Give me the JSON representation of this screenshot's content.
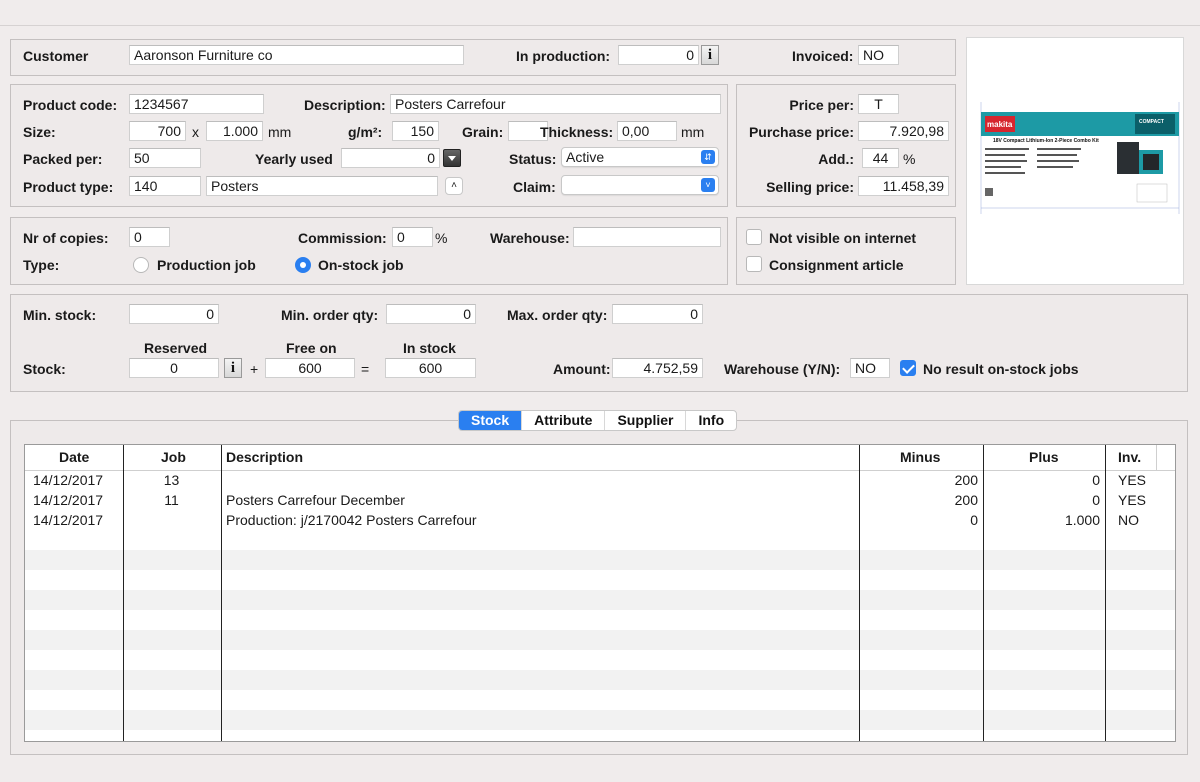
{
  "customer": {
    "label": "Customer",
    "value": "Aaronson Furniture co",
    "in_production_label": "In production:",
    "in_production_value": "0",
    "invoiced_label": "Invoiced:",
    "invoiced_value": "NO"
  },
  "product": {
    "code_label": "Product code:",
    "code": "1234567",
    "description_label": "Description:",
    "description": "Posters Carrefour",
    "size_label": "Size:",
    "size_w": "700",
    "size_x": "x",
    "size_h": "1.000",
    "size_unit": "mm",
    "gsm_label": "g/m²:",
    "gsm": "150",
    "grain_label": "Grain:",
    "grain": "",
    "thickness_label": "Thickness:",
    "thickness": "0,00",
    "thickness_unit": "mm",
    "packed_label": "Packed per:",
    "packed": "50",
    "yearly_label": "Yearly used",
    "yearly": "0",
    "status_label": "Status:",
    "status": "Active",
    "type_label": "Product type:",
    "type_code": "140",
    "type_name": "Posters",
    "claim_label": "Claim:",
    "claim": ""
  },
  "price": {
    "price_per_label": "Price per:",
    "price_per": "T",
    "purchase_label": "Purchase price:",
    "purchase": "7.920,98",
    "add_label": "Add.:",
    "add": "44",
    "add_unit": "%",
    "selling_label": "Selling price:",
    "selling": "11.458,39"
  },
  "copies": {
    "nr_label": "Nr of copies:",
    "nr": "0",
    "commission_label": "Commission:",
    "commission": "0",
    "commission_unit": "%",
    "warehouse_label": "Warehouse:",
    "warehouse": "",
    "type_label": "Type:",
    "production_job": "Production job",
    "onstock_job": "On-stock job"
  },
  "flags": {
    "not_visible": "Not visible on internet",
    "consignment": "Consignment article"
  },
  "stock": {
    "min_stock_label": "Min. stock:",
    "min_stock": "0",
    "min_order_label": "Min. order qty:",
    "min_order": "0",
    "max_order_label": "Max. order qty:",
    "max_order": "0",
    "stock_label": "Stock:",
    "reserved_label": "Reserved",
    "reserved": "0",
    "plus": "+",
    "free_label": "Free on",
    "free": "600",
    "equals": "=",
    "instock_label": "In stock",
    "instock": "600",
    "amount_label": "Amount:",
    "amount": "4.752,59",
    "warehouse_yn_label": "Warehouse (Y/N):",
    "warehouse_yn": "NO",
    "no_result_label": "No result on-stock jobs"
  },
  "tabs": [
    {
      "label": "Stock",
      "active": true
    },
    {
      "label": "Attribute",
      "active": false
    },
    {
      "label": "Supplier",
      "active": false
    },
    {
      "label": "Info",
      "active": false
    }
  ],
  "table": {
    "headers": [
      "Date",
      "Job",
      "Description",
      "Minus",
      "Plus",
      "Inv."
    ],
    "rows": [
      [
        "14/12/2017",
        "13",
        "",
        "200",
        "0",
        "YES"
      ],
      [
        "14/12/2017",
        "11",
        "Posters Carrefour December",
        "200",
        "0",
        "YES"
      ],
      [
        "14/12/2017",
        "",
        "Production: j/2170042 Posters Carrefour",
        "0",
        "1.000",
        "NO"
      ]
    ]
  },
  "thumbnail": {
    "brand": "makita",
    "headline": "18V Compact Lithium-Ion 2-Piece Combo Kit",
    "badge": "COMPACT"
  },
  "colors": {
    "accent": "#2a7ff0",
    "background": "#f0ecec",
    "thumb_teal": "#1d9aa5",
    "thumb_red": "#d6262e"
  }
}
